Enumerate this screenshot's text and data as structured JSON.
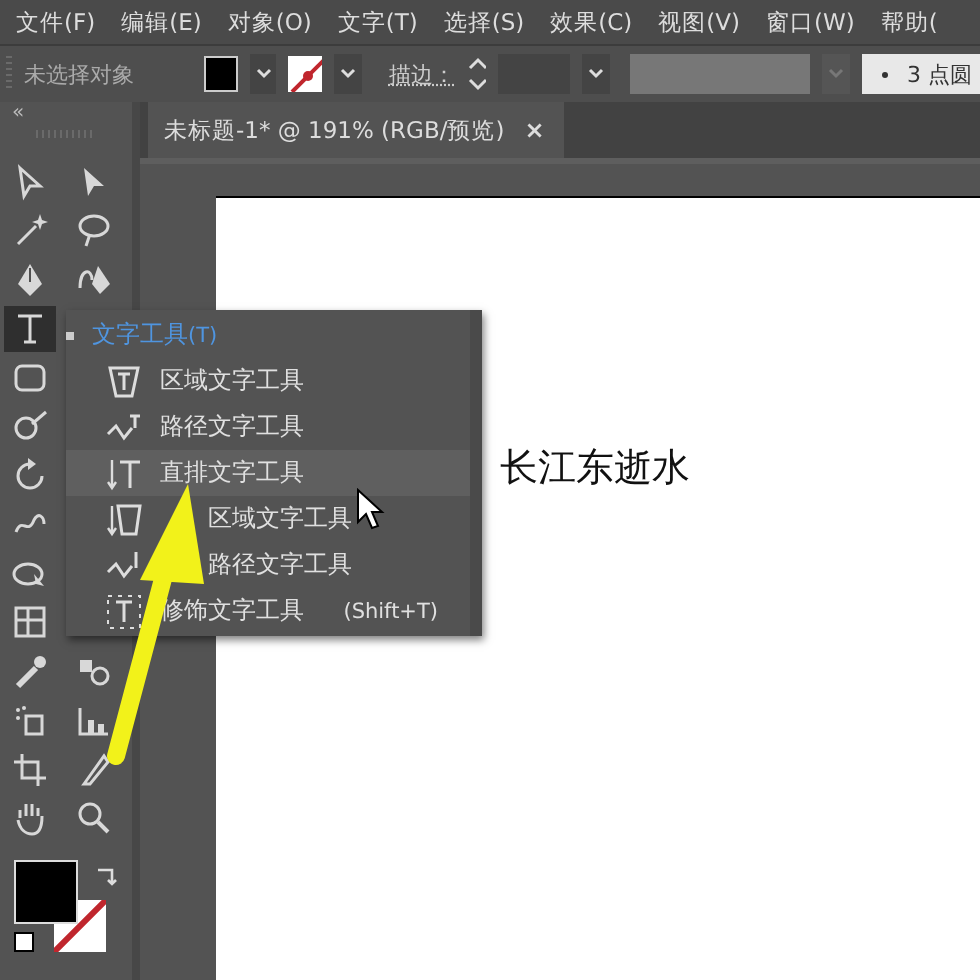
{
  "menu_bar": [
    "文件(F)",
    "编辑(E)",
    "对象(O)",
    "文字(T)",
    "选择(S)",
    "效果(C)",
    "视图(V)",
    "窗口(W)",
    "帮助("
  ],
  "control_bar": {
    "selection": "未选择对象",
    "stroke_label": "描边：",
    "brush_field": "3 点圆"
  },
  "toolbar": {
    "collapse": "«",
    "tools": [
      {
        "selected": false
      },
      {
        "selected": false
      },
      {
        "selected": false
      },
      {
        "selected": false
      },
      {
        "selected": false
      },
      {
        "selected": false
      },
      {
        "selected": true
      },
      {
        "selected": false
      },
      {
        "selected": false
      },
      {
        "selected": false
      },
      {
        "selected": false
      },
      {
        "selected": false
      },
      {
        "selected": false
      },
      {
        "selected": false
      },
      {
        "selected": false
      },
      {
        "selected": false
      },
      {
        "selected": false
      },
      {
        "selected": false
      },
      {
        "selected": false
      },
      {
        "selected": false
      },
      {
        "selected": false
      }
    ]
  },
  "document_tab": {
    "title": "未标题-1* @ 191% (RGB/预览)",
    "close": "×"
  },
  "artboard": {
    "text": "长江东逝水"
  },
  "flyout": [
    {
      "label": "文字工具",
      "shortcut": "(T)",
      "selected": true,
      "hovered": false
    },
    {
      "label": "区域文字工具",
      "selected": false,
      "hovered": false
    },
    {
      "label": "路径文字工具",
      "selected": false,
      "hovered": false
    },
    {
      "label": "直排文字工具",
      "selected": false,
      "hovered": true
    },
    {
      "label": "区域文字工具",
      "selected": false,
      "hovered": false,
      "covered": true
    },
    {
      "label": "路径文字工具",
      "selected": false,
      "hovered": false,
      "covered": true
    },
    {
      "label": "修饰文字工具",
      "shortcut": "(Shift+T)",
      "selected": false,
      "hovered": false
    }
  ]
}
